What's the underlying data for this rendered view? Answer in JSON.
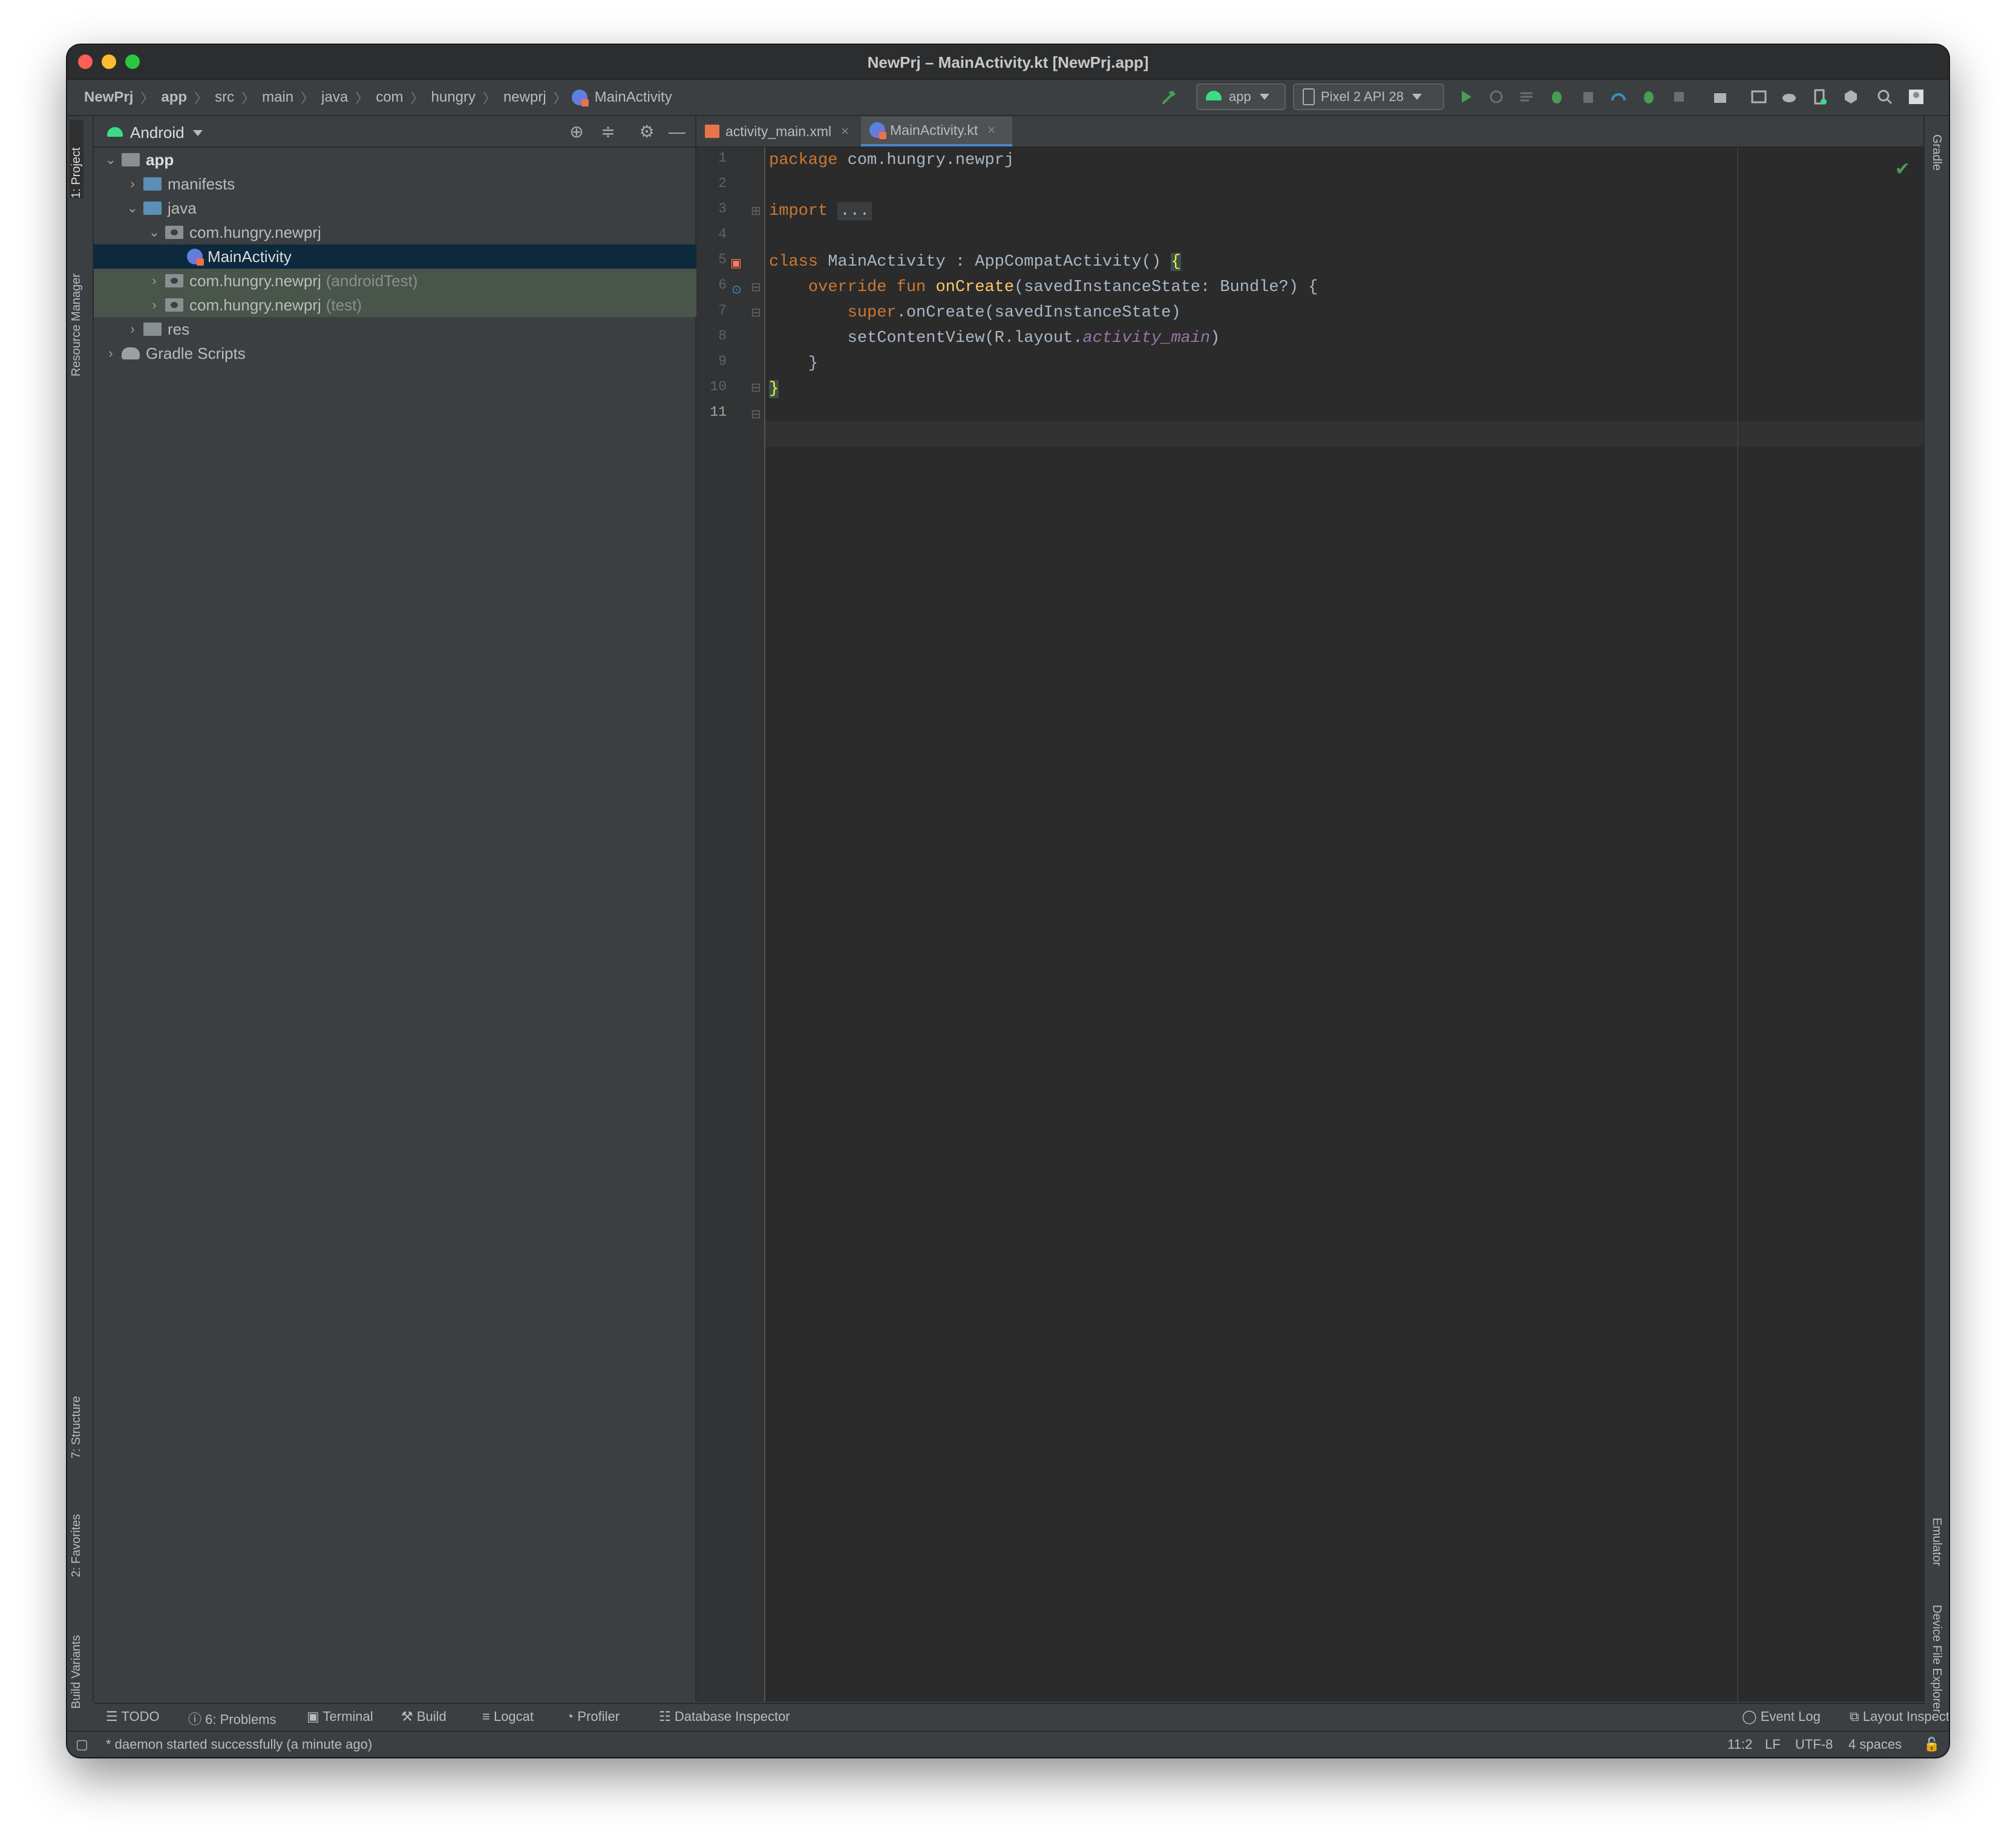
{
  "window": {
    "title": "NewPrj – MainActivity.kt [NewPrj.app]"
  },
  "breadcrumbs": [
    "NewPrj",
    "app",
    "src",
    "main",
    "java",
    "com",
    "hungry",
    "newprj",
    "MainActivity"
  ],
  "toolbar": {
    "run_config": "app",
    "device": "Pixel 2 API 28"
  },
  "left_tools": {
    "project": "1: Project",
    "resource_manager": "Resource Manager",
    "structure": "7: Structure",
    "favorites": "2: Favorites",
    "build_variants": "Build Variants"
  },
  "right_tools": {
    "gradle": "Gradle",
    "emulator": "Emulator",
    "device_file_explorer": "Device File Explorer"
  },
  "project_panel": {
    "view": "Android",
    "tree": [
      {
        "label": "app"
      },
      {
        "label": "manifests"
      },
      {
        "label": "java"
      },
      {
        "label": "com.hungry.newprj"
      },
      {
        "label": "MainActivity"
      },
      {
        "label": "com.hungry.newprj",
        "suffix": "(androidTest)"
      },
      {
        "label": "com.hungry.newprj",
        "suffix": "(test)"
      },
      {
        "label": "res"
      },
      {
        "label": "Gradle Scripts"
      }
    ]
  },
  "editor": {
    "tabs": [
      {
        "label": "activity_main.xml"
      },
      {
        "label": "MainActivity.kt"
      }
    ],
    "line_numbers": [
      "1",
      "2",
      "3",
      "4",
      "5",
      "6",
      "7",
      "8",
      "9",
      "10",
      "11"
    ],
    "code": {
      "l1_kw": "package",
      "l1_rest": " com.hungry.newprj",
      "l3_kw": "import",
      "l3_fold": "...",
      "l6_kw": "class",
      "l6_rest": " MainActivity : AppCompatActivity() ",
      "l6_brace": "{",
      "l7_kw": "override fun ",
      "l7_fn": "onCreate",
      "l7_rest": "(savedInstanceState: Bundle?) {",
      "l8_kw": "super",
      "l8_rest": ".onCreate(savedInstanceState)",
      "l9_rest": "setContentView(R.layout.",
      "l9_it": "activity_main",
      "l9_end": ")",
      "l10": "}",
      "l11": "}"
    }
  },
  "bottom_tools": {
    "todo": "TODO",
    "problems": "6: Problems",
    "terminal": "Terminal",
    "build": "Build",
    "logcat": "Logcat",
    "profiler": "Profiler",
    "database_inspector": "Database Inspector",
    "event_log": "Event Log",
    "layout_inspector": "Layout Inspector"
  },
  "status": {
    "message": "* daemon started successfully (a minute ago)",
    "position": "11:2",
    "line_sep": "LF",
    "encoding": "UTF-8",
    "indent": "4 spaces"
  },
  "colors": {
    "keyword": "#cc7832",
    "function": "#ffc66d",
    "field": "#9876aa",
    "selection": "#0d293e",
    "accent": "#4a88c7"
  }
}
